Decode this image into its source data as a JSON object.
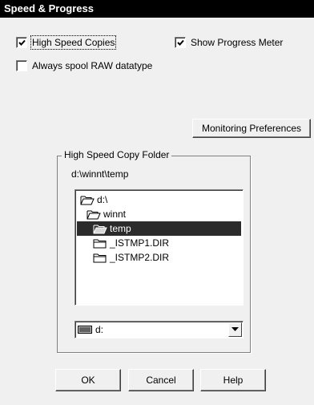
{
  "window": {
    "title": "Speed & Progress"
  },
  "options": {
    "high_speed_copies": {
      "label": "High Speed Copies",
      "checked": true
    },
    "show_progress_meter": {
      "label": "Show Progress Meter",
      "checked": true
    },
    "always_spool_raw": {
      "label": "Always spool RAW datatype",
      "checked": false
    }
  },
  "buttons": {
    "monitoring_preferences": "Monitoring Preferences",
    "ok": "OK",
    "cancel": "Cancel",
    "help": "Help"
  },
  "folder_group": {
    "title": "High Speed Copy Folder",
    "current_path": "d:\\winnt\\temp",
    "tree": [
      {
        "label": "d:\\",
        "icon": "open-folder-icon",
        "selected": false
      },
      {
        "label": "winnt",
        "icon": "open-folder-icon",
        "selected": false
      },
      {
        "label": "temp",
        "icon": "open-folder-icon",
        "selected": true
      },
      {
        "label": "_ISTMP1.DIR",
        "icon": "closed-folder-icon",
        "selected": false
      },
      {
        "label": "_ISTMP2.DIR",
        "icon": "closed-folder-icon",
        "selected": false
      }
    ],
    "drive": {
      "value": "d:",
      "icon": "drive-icon"
    }
  }
}
